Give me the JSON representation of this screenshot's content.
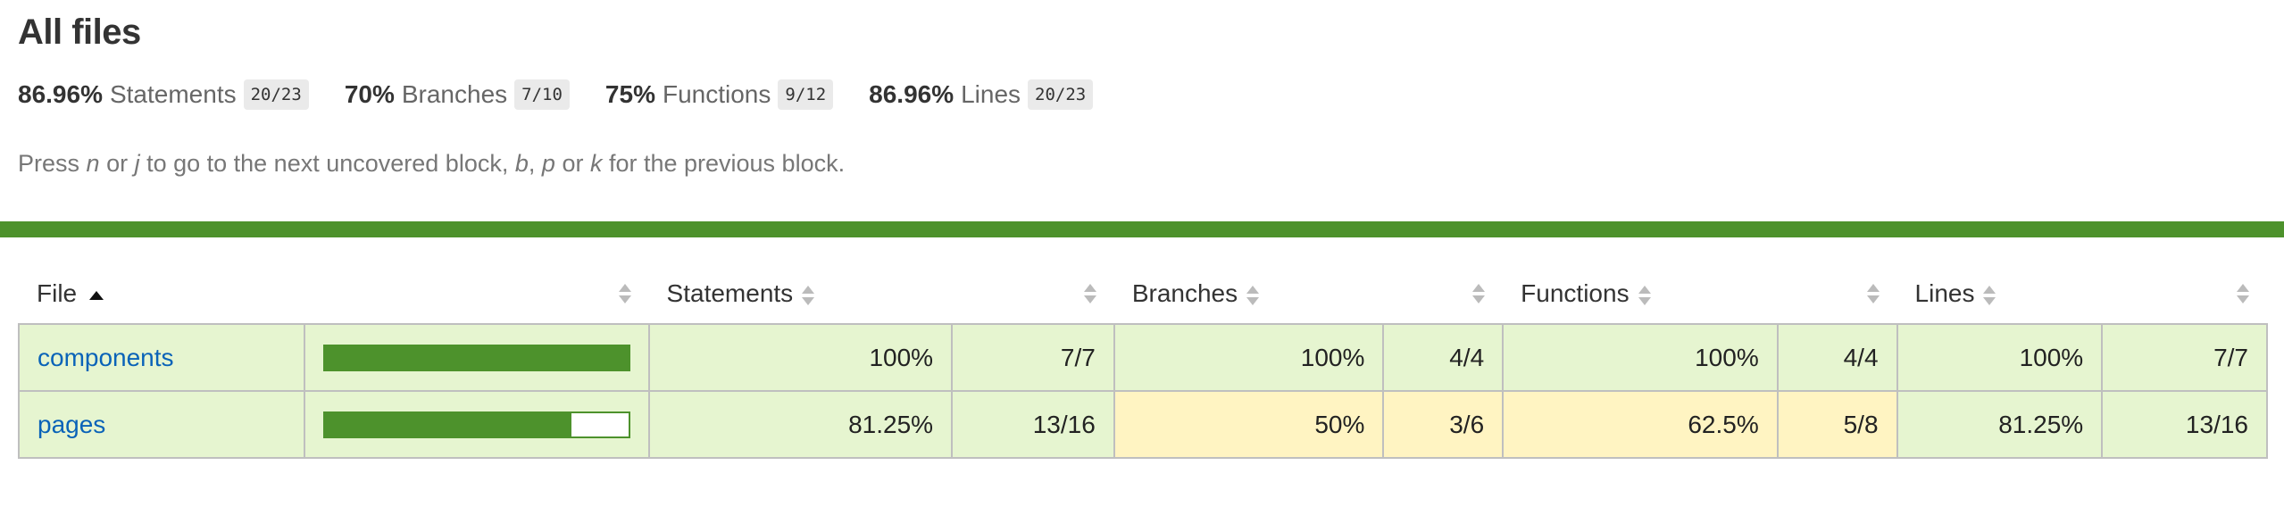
{
  "title": "All files",
  "summary": [
    {
      "pct": "86.96%",
      "label": "Statements",
      "frac": "20/23"
    },
    {
      "pct": "70%",
      "label": "Branches",
      "frac": "7/10"
    },
    {
      "pct": "75%",
      "label": "Functions",
      "frac": "9/12"
    },
    {
      "pct": "86.96%",
      "label": "Lines",
      "frac": "20/23"
    }
  ],
  "hint": {
    "p1": "Press ",
    "k1": "n",
    "p2": " or ",
    "k2": "j",
    "p3": " to go to the next uncovered block, ",
    "k3": "b",
    "p4": ", ",
    "k4": "p",
    "p5": " or ",
    "k5": "k",
    "p6": " for the previous block."
  },
  "colors": {
    "accent": "#4d922c",
    "high": "#e6f5d0",
    "medium": "#fff4c2",
    "link": "#0a63b8"
  },
  "table": {
    "headers": {
      "file": "File",
      "statements": "Statements",
      "branches": "Branches",
      "functions": "Functions",
      "lines": "Lines"
    },
    "rows": [
      {
        "file": "components",
        "coverage": 1.0,
        "statements_pct": "100%",
        "statements_frac": "7/7",
        "branches_pct": "100%",
        "branches_frac": "4/4",
        "functions_pct": "100%",
        "functions_frac": "4/4",
        "lines_pct": "100%",
        "lines_frac": "7/7",
        "levels": {
          "statements": "high",
          "branches": "high",
          "functions": "high",
          "lines": "high"
        }
      },
      {
        "file": "pages",
        "coverage": 0.8125,
        "statements_pct": "81.25%",
        "statements_frac": "13/16",
        "branches_pct": "50%",
        "branches_frac": "3/6",
        "functions_pct": "62.5%",
        "functions_frac": "5/8",
        "lines_pct": "81.25%",
        "lines_frac": "13/16",
        "levels": {
          "statements": "high",
          "branches": "medium",
          "functions": "medium",
          "lines": "high"
        }
      }
    ]
  }
}
